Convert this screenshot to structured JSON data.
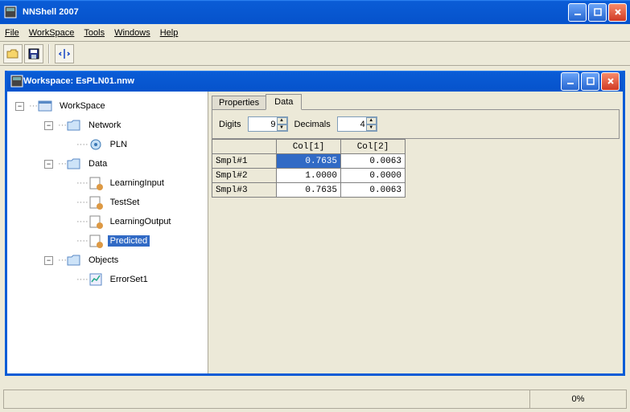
{
  "app": {
    "title": "NNShell 2007"
  },
  "menu": {
    "file": "File",
    "workspace": "WorkSpace",
    "tools": "Tools",
    "windows": "Windows",
    "help": "Help"
  },
  "mdi": {
    "title": "Workspace: EsPLN01.nnw"
  },
  "tree": {
    "root": "WorkSpace",
    "network": "Network",
    "pln": "PLN",
    "data": "Data",
    "learningInput": "LearningInput",
    "testSet": "TestSet",
    "learningOutput": "LearningOutput",
    "predicted": "Predicted",
    "objects": "Objects",
    "errorSet1": "ErrorSet1"
  },
  "tabs": {
    "properties": "Properties",
    "data": "Data"
  },
  "controls": {
    "digitsLabel": "Digits",
    "digitsValue": "9",
    "decimalsLabel": "Decimals",
    "decimalsValue": "4"
  },
  "grid": {
    "cols": [
      "Col[1]",
      "Col[2]"
    ],
    "rows": [
      {
        "h": "Smpl#1",
        "c1": "0.7635",
        "c2": "0.0063"
      },
      {
        "h": "Smpl#2",
        "c1": "1.0000",
        "c2": "0.0000"
      },
      {
        "h": "Smpl#3",
        "c1": "0.7635",
        "c2": "0.0063"
      }
    ]
  },
  "status": {
    "pct": "0%"
  }
}
